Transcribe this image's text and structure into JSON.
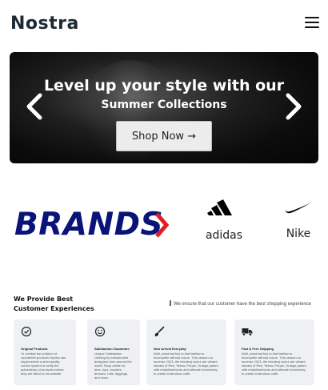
{
  "header": {
    "logo": "Nostra",
    "menu_icon": "hamburger-menu-icon"
  },
  "hero": {
    "title": "Level up your style with our",
    "subtitle": "Summer Collections",
    "cta_label": "Shop Now →",
    "prev_icon": "chevron-left-icon",
    "next_icon": "chevron-right-icon"
  },
  "brands": {
    "title": "BRANDS",
    "title_color": "#0a1478",
    "chevron_color": "#e01c24",
    "items": [
      {
        "name": "adidas",
        "icon": "adidas-logo-icon"
      },
      {
        "name": "Nike",
        "icon": "nike-swoosh-icon"
      }
    ]
  },
  "experience": {
    "heading": "We Provide Best Customer Experiences",
    "tagline": "We ensure that our customer have the best shopping experience",
    "cards": [
      {
        "icon": "check-circle-icon",
        "title": "Original Products",
        "text": "To combat the problem of counterfeit products Myntra has implemented a strict quality control system to verify the authenticity of products before they are listed on its website."
      },
      {
        "icon": "smiley-icon",
        "title": "Satisfaction Guarantee",
        "text": "Unique Satisfaction clothing by independent designers from around the world. Shop online for tees, tops, hoodies, dresses, hats, leggings, and more."
      },
      {
        "icon": "brush-icon",
        "title": "New Arrival Everyday",
        "text": "Well, universal fact is that fashion is incomplete without colors. This season on, summer 2023, the trending colors are vibrant shades of Red, Yellow, Purple, Orange paired with embellishments and intricate embroidery to create a fabulous outfit."
      },
      {
        "icon": "truck-icon",
        "title": "Fast & Free Shipping",
        "text": "Well, universal fact is that fashion is incomplete without colors. This season on, summer 2023, the trending colors are vibrant shades of Red, Yellow, Purple, Orange paired with embellishments and intricate embroidery to create a fabulous outfit."
      }
    ]
  }
}
